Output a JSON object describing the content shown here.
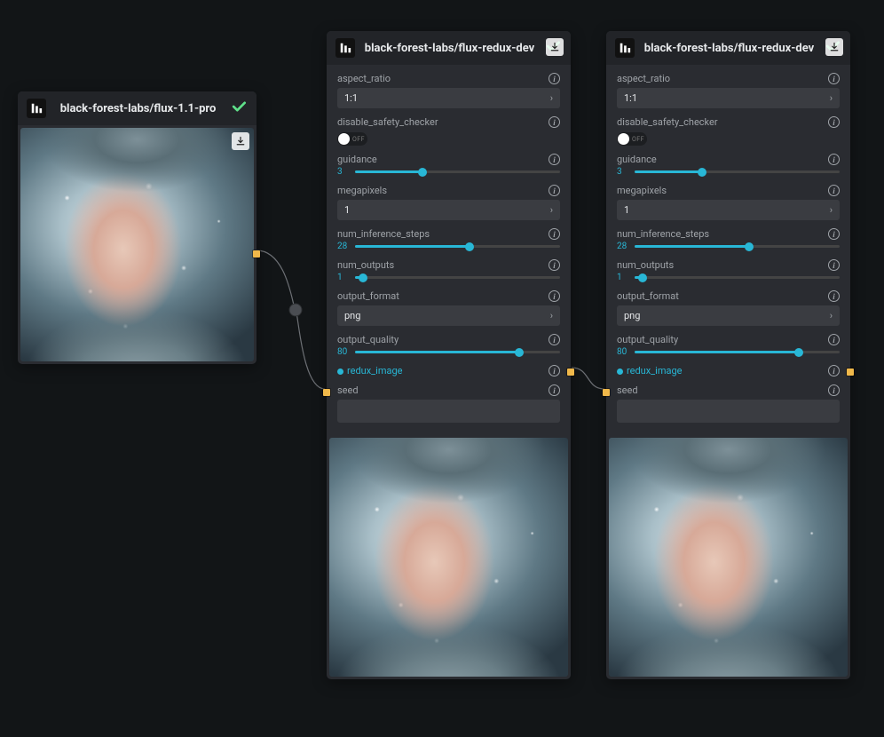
{
  "source_node": {
    "title": "black-forest-labs/flux-1.1-pro",
    "status": "ok"
  },
  "redux_node": {
    "title": "black-forest-labs/flux-redux-dev",
    "status": "ok",
    "params": {
      "aspect_ratio": {
        "label": "aspect_ratio",
        "value": "1:1"
      },
      "disable_safety_checker": {
        "label": "disable_safety_checker",
        "state": "OFF"
      },
      "guidance": {
        "label": "guidance",
        "value": 3,
        "min": 0,
        "max": 10,
        "pct": 33
      },
      "megapixels": {
        "label": "megapixels",
        "value": "1"
      },
      "num_inference_steps": {
        "label": "num_inference_steps",
        "value": 28,
        "min": 0,
        "max": 50,
        "pct": 56
      },
      "num_outputs": {
        "label": "num_outputs",
        "value": 1,
        "min": 1,
        "max": 10,
        "pct": 4
      },
      "output_format": {
        "label": "output_format",
        "value": "png"
      },
      "output_quality": {
        "label": "output_quality",
        "value": 80,
        "min": 0,
        "max": 100,
        "pct": 80
      },
      "redux_image": {
        "label": "redux_image"
      },
      "seed": {
        "label": "seed"
      }
    }
  }
}
